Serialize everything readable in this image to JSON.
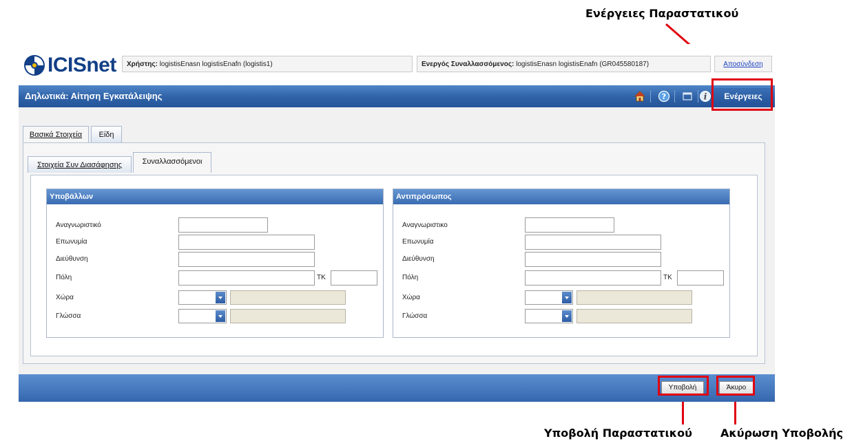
{
  "annotations": {
    "actions": "Ενέργειες Παραστατικού",
    "submit": "Υποβολή Παραστατικού",
    "cancel": "Ακύρωση Υποβολής"
  },
  "header": {
    "logo_text": "ICISnet",
    "user_label": "Χρήστης:",
    "user_value": "logistisEnasn logistisEnafn (logistis1)",
    "trader_label": "Ενεργός Συναλλασσόμενος:",
    "trader_value": "logistisEnasn logistisEnafn (GR045580187)",
    "logout_label": "Αποσύνδεση"
  },
  "titlebar": {
    "title": "Δηλωτικά: Αίτηση Εγκατάλειψης",
    "icons": [
      "home-icon",
      "help-icon",
      "window-icon",
      "info-icon"
    ],
    "actions_label": "Ενέργειες"
  },
  "tabs": {
    "main": [
      "Βασικά Στοιχεία",
      "Είδη"
    ],
    "sub": [
      "Στοιχεία Συν Διασάφησης",
      "Συναλλασσόμενοι"
    ]
  },
  "left_group": {
    "title": "Υποβάλλων",
    "labels": {
      "id": "Αναγνωριστικό",
      "name": "Επωνυμία",
      "address": "Διεύθυνση",
      "city": "Πόλη",
      "postcode": "ΤΚ",
      "country": "Χώρα",
      "language": "Γλώσσα"
    }
  },
  "right_group": {
    "title": "Αντιπρόσωπος",
    "labels": {
      "id": "Αναγνωριστικο",
      "name": "Επωνυμία",
      "address": "Διεύθυνση",
      "city": "Πόλη",
      "postcode": "ΤΚ",
      "country": "Χώρα",
      "language": "Γλώσσα"
    }
  },
  "footer": {
    "submit_label": "Υποβολή",
    "cancel_label": "Άκυρο"
  },
  "colors": {
    "accent_blue": "#2f62a7",
    "annotation_red": "#e00010"
  }
}
